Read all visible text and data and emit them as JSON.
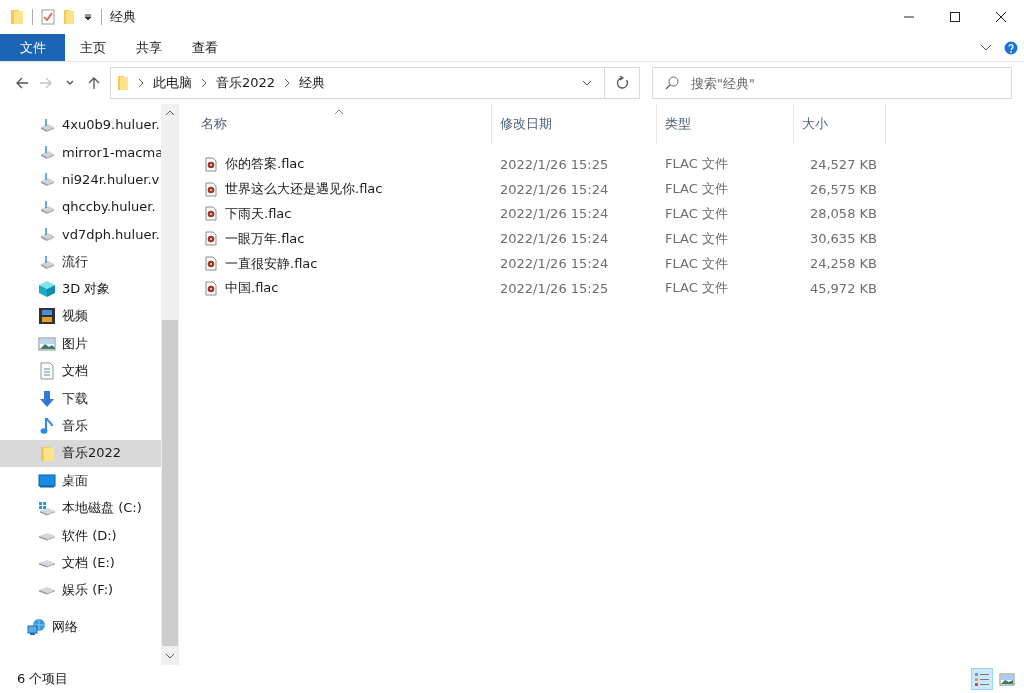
{
  "window": {
    "title": "经典"
  },
  "ribbon": {
    "tabs": [
      {
        "label": "文件",
        "kind": "file"
      },
      {
        "label": "主页",
        "kind": "tab"
      },
      {
        "label": "共享",
        "kind": "tab"
      },
      {
        "label": "查看",
        "kind": "tab"
      }
    ]
  },
  "navigation": [
    {
      "kind": "back",
      "disabled": false
    },
    {
      "kind": "forward",
      "disabled": true
    },
    {
      "kind": "recent",
      "disabled": false
    },
    {
      "kind": "up",
      "disabled": false
    }
  ],
  "address_bar": {
    "path": [
      "此电脑",
      "音乐2022",
      "经典"
    ]
  },
  "search": {
    "placeholder": "搜索\"经典\""
  },
  "sidebar": {
    "items": [
      {
        "label": "4xu0b9.huluer.",
        "kind": "netdrive",
        "selected": false
      },
      {
        "label": "mirror1-macma",
        "kind": "netdrive",
        "selected": false
      },
      {
        "label": "ni924r.huluer.v",
        "kind": "netdrive",
        "selected": false
      },
      {
        "label": "qhccby.huluer.",
        "kind": "netdrive",
        "selected": false
      },
      {
        "label": "vd7dph.huluer.",
        "kind": "netdrive",
        "selected": false
      },
      {
        "label": "流行",
        "kind": "netdrive",
        "selected": false
      },
      {
        "label": "3D 对象",
        "kind": "cube",
        "selected": false
      },
      {
        "label": "视频",
        "kind": "video",
        "selected": false
      },
      {
        "label": "图片",
        "kind": "picture",
        "selected": false
      },
      {
        "label": "文档",
        "kind": "doc",
        "selected": false
      },
      {
        "label": "下载",
        "kind": "download",
        "selected": false
      },
      {
        "label": "音乐",
        "kind": "music",
        "selected": false
      },
      {
        "label": "音乐2022",
        "kind": "folder",
        "selected": true
      },
      {
        "label": "桌面",
        "kind": "desktop",
        "selected": false
      },
      {
        "label": "本地磁盘 (C:)",
        "kind": "windisk",
        "selected": false
      },
      {
        "label": "软件 (D:)",
        "kind": "disk",
        "selected": false
      },
      {
        "label": "文档 (E:)",
        "kind": "disk",
        "selected": false
      },
      {
        "label": "娱乐 (F:)",
        "kind": "disk",
        "selected": false
      },
      {
        "label": "网络",
        "kind": "network",
        "selected": false
      }
    ]
  },
  "file_list": {
    "columns": [
      {
        "label": "名称",
        "sorted": true
      },
      {
        "label": "修改日期",
        "sorted": false
      },
      {
        "label": "类型",
        "sorted": false
      },
      {
        "label": "大小",
        "sorted": false
      }
    ],
    "rows": [
      {
        "name": "你的答案.flac",
        "modified": "2022/1/26 15:25",
        "type": "FLAC 文件",
        "size": "24,527 KB"
      },
      {
        "name": "世界这么大还是遇见你.flac",
        "modified": "2022/1/26 15:24",
        "type": "FLAC 文件",
        "size": "26,575 KB"
      },
      {
        "name": "下雨天.flac",
        "modified": "2022/1/26 15:24",
        "type": "FLAC 文件",
        "size": "28,058 KB"
      },
      {
        "name": "一眼万年.flac",
        "modified": "2022/1/26 15:24",
        "type": "FLAC 文件",
        "size": "30,635 KB"
      },
      {
        "name": "一直很安静.flac",
        "modified": "2022/1/26 15:24",
        "type": "FLAC 文件",
        "size": "24,258 KB"
      },
      {
        "name": "中国.flac",
        "modified": "2022/1/26 15:25",
        "type": "FLAC 文件",
        "size": "45,972 KB"
      }
    ]
  },
  "status_bar": {
    "item_count": "6 个项目",
    "views": [
      {
        "kind": "details",
        "selected": true
      },
      {
        "kind": "large-icons",
        "selected": false
      }
    ]
  }
}
